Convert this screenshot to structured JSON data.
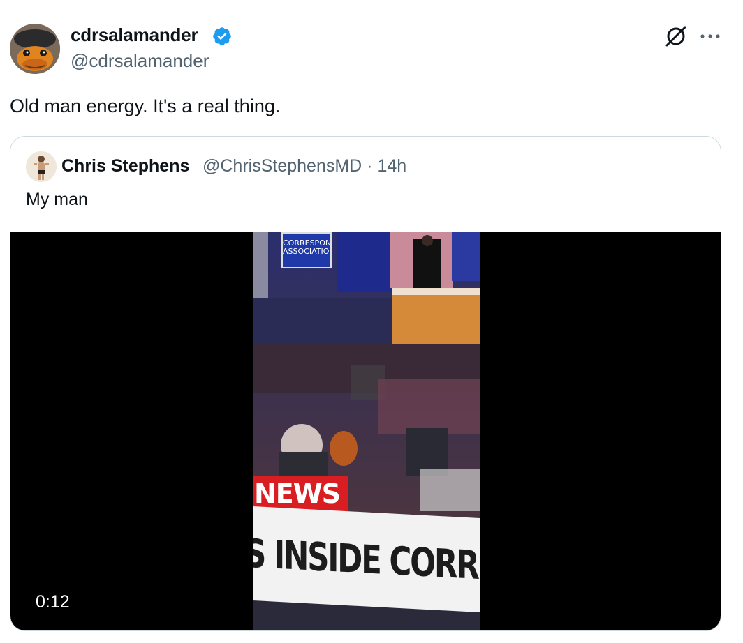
{
  "tweet": {
    "author_name": "cdrsalamander",
    "author_handle": "@cdrsalamander",
    "text": "Old man energy. It's a real thing.",
    "icons": {
      "verified": "verified-badge-icon",
      "grok": "grok-icon",
      "more": "more-options-icon"
    },
    "accent_color": "#1d9bf0"
  },
  "quote": {
    "author_name": "Chris Stephens",
    "author_handle_time": "@ChrisStephensMD · 14h",
    "text": "My man",
    "video": {
      "timestamp": "0:12",
      "news_tag": "NEWS",
      "chyron": "S INSIDE CORRESPON",
      "sign_text": "CORRESPONDENTS' ASSOCIATION"
    }
  }
}
